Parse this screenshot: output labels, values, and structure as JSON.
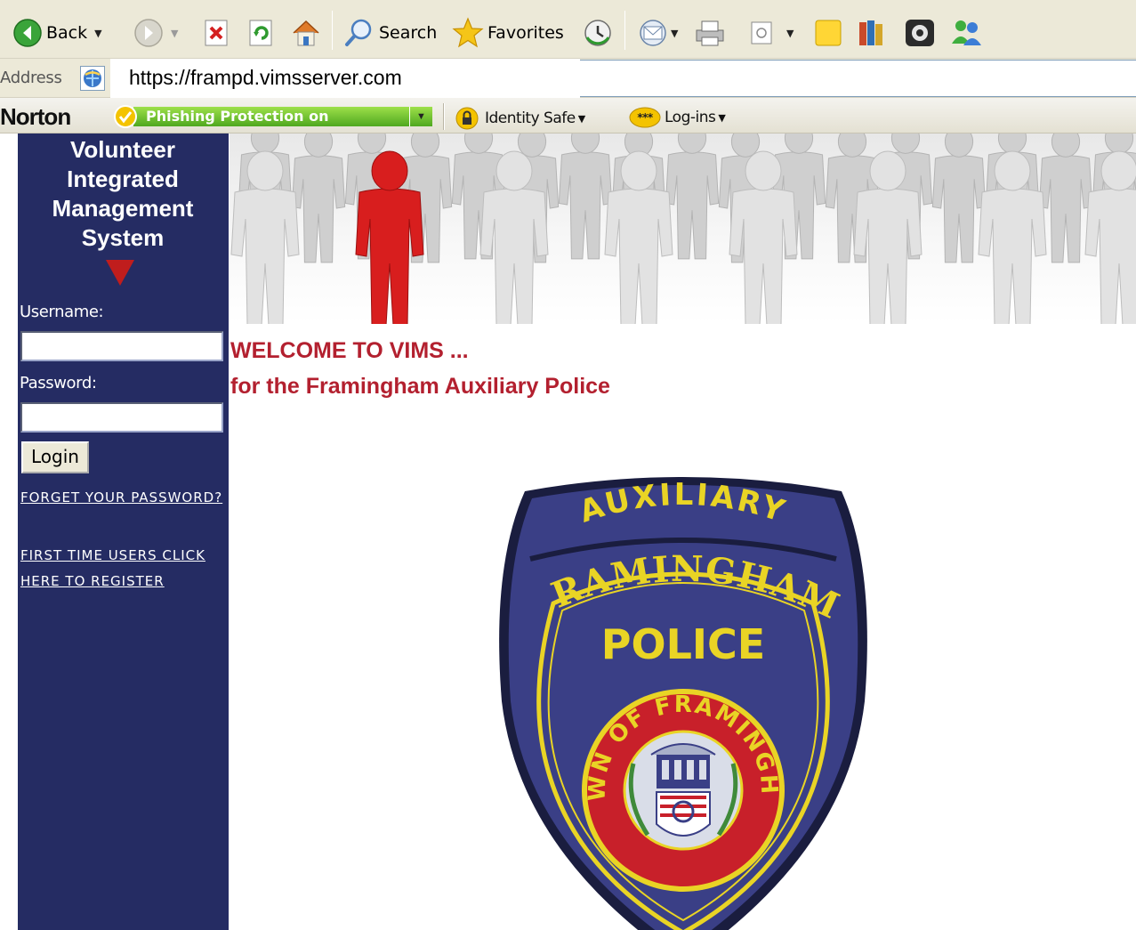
{
  "toolbar": {
    "back_label": "Back",
    "search_label": "Search",
    "favorites_label": "Favorites"
  },
  "address_bar": {
    "label": "Address",
    "url": "https://frampd.vimsserver.com"
  },
  "norton_bar": {
    "brand": "Norton",
    "phishing_status": "Phishing Protection on",
    "identity_safe_label": "Identity Safe",
    "logins_label": "Log-ins"
  },
  "sidebar": {
    "title_lines": [
      "Volunteer",
      "Integrated",
      "Management",
      "System"
    ],
    "username_label": "Username:",
    "username_value": "",
    "password_label": "Password:",
    "password_value": "",
    "login_label": "Login",
    "forgot_link": "FORGET YOUR PASSWORD?",
    "register_link_line1": "FIRST TIME USERS CLICK",
    "register_link_line2": "HERE TO REGISTER"
  },
  "main": {
    "welcome_line1": "WELCOME TO VIMS ...",
    "welcome_line2": "for the Framingham Auxiliary Police"
  },
  "badge": {
    "top_text": "AUXILIARY",
    "arc_text": "FRAMINGHAM",
    "center_text": "POLICE",
    "seal_text": "TOWN OF FRAMINGHAM"
  },
  "colors": {
    "sidebar_bg": "#252c63",
    "welcome_text": "#b3202f",
    "badge_fabric": "#3a3f86",
    "badge_thread": "#e9d425",
    "seal_red": "#c8202a",
    "highlight_figure": "#d81e1e"
  }
}
